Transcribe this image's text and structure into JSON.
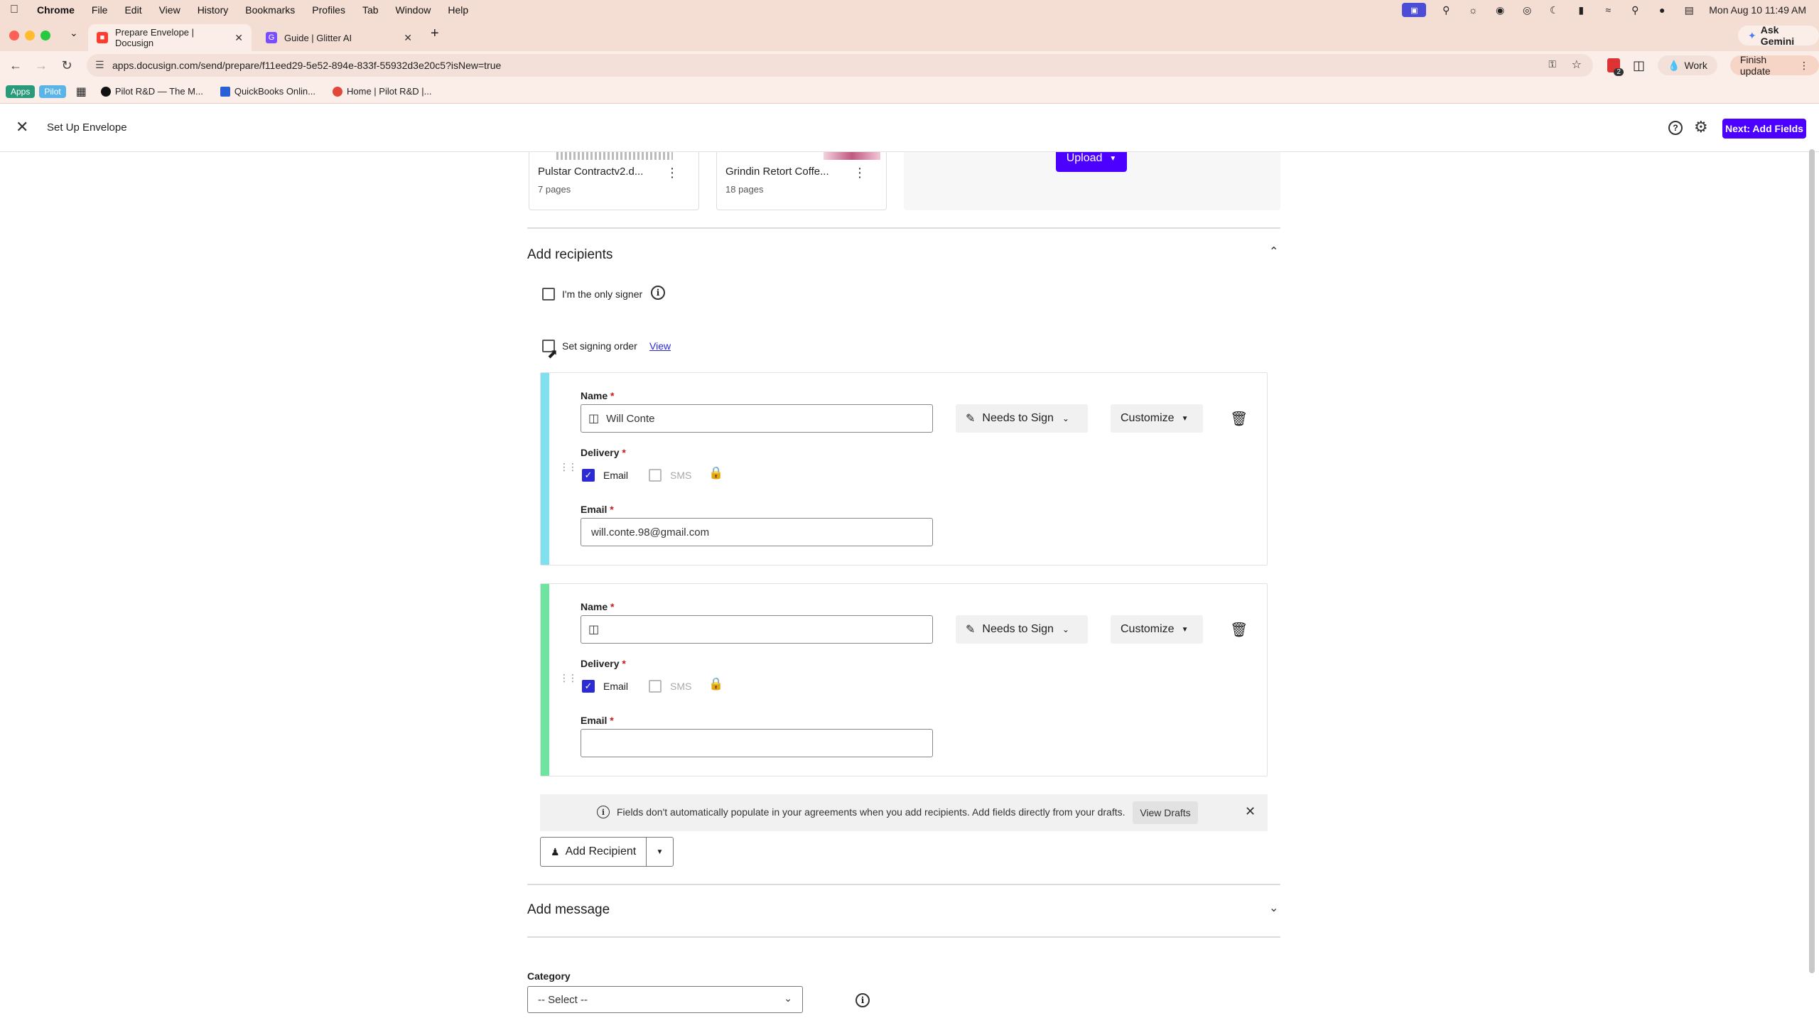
{
  "menubar": {
    "app": "Chrome",
    "items": [
      "File",
      "Edit",
      "View",
      "History",
      "Bookmarks",
      "Profiles",
      "Tab",
      "Window",
      "Help"
    ],
    "datetime": "Mon Aug 10  11:49 AM"
  },
  "browser": {
    "tabs": [
      {
        "title": "Prepare Envelope | Docusign",
        "active": true
      },
      {
        "title": "Guide | Glitter AI",
        "active": false
      }
    ],
    "url": "apps.docusign.com/send/prepare/f11eed29-5e52-894e-833f-55932d3e20c5?isNew=true",
    "ask_gemini": "Ask Gemini",
    "profile": "Work",
    "finish_update": "Finish update",
    "extension_badge": "2",
    "bookmarks": {
      "apps": "Apps",
      "pilot": "Pilot",
      "items": [
        "Pilot R&D — The M...",
        "QuickBooks Onlin...",
        "Home | Pilot R&D |..."
      ]
    }
  },
  "header": {
    "title": "Set Up Envelope",
    "next_label": "Next: Add Fields"
  },
  "documents": [
    {
      "name": "Pulstar Contractv2.d...",
      "pages": "7 pages"
    },
    {
      "name": "Grindin Retort Coffe...",
      "pages": "18 pages"
    }
  ],
  "upload_label": "Upload",
  "recipients": {
    "heading": "Add recipients",
    "only_signer": "I'm the only signer",
    "signing_order": "Set signing order",
    "view_link": "View",
    "name_label": "Name",
    "delivery_label": "Delivery",
    "email_label": "Email",
    "email_option": "Email",
    "sms_option": "SMS",
    "action_label": "Needs to Sign",
    "customize_label": "Customize",
    "list": [
      {
        "name": "Will Conte",
        "email": "will.conte.98@gmail.com",
        "color": "#7fe0f0"
      },
      {
        "name": "",
        "email": "",
        "color": "#6fe3a0"
      }
    ],
    "banner_text": "Fields don't automatically populate in your agreements when you add recipients. Add fields directly from your drafts.",
    "view_drafts": "View Drafts",
    "add_recipient": "Add Recipient"
  },
  "message": {
    "heading": "Add message"
  },
  "category": {
    "label": "Category",
    "selected": "-- Select --"
  },
  "colors": {
    "primary": "#4c00ff",
    "checkbox": "#2b2ad6"
  }
}
